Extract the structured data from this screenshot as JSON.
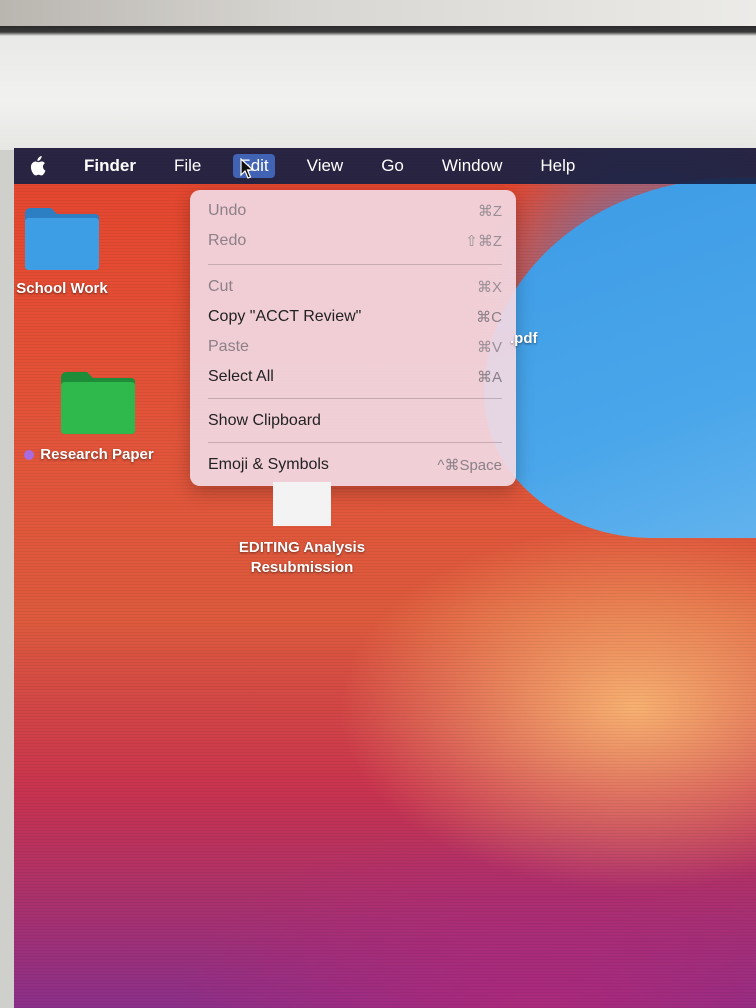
{
  "menubar": {
    "apple_icon": "apple-icon",
    "items": [
      "Finder",
      "File",
      "Edit",
      "View",
      "Go",
      "Window",
      "Help"
    ],
    "active": "Edit"
  },
  "edit_menu": {
    "items": [
      {
        "label": "Undo",
        "shortcut": "⌘Z",
        "enabled": false
      },
      {
        "label": "Redo",
        "shortcut": "⇧⌘Z",
        "enabled": false
      },
      {
        "label": "Cut",
        "shortcut": "⌘X",
        "enabled": false
      },
      {
        "label": "Copy \"ACCT Review\"",
        "shortcut": "⌘C",
        "enabled": true
      },
      {
        "label": "Paste",
        "shortcut": "⌘V",
        "enabled": false
      },
      {
        "label": "Select All",
        "shortcut": "⌘A",
        "enabled": true
      },
      {
        "label": "Show Clipboard",
        "shortcut": "",
        "enabled": true
      },
      {
        "label": "Emoji & Symbols",
        "shortcut": "^⌘Space",
        "enabled": true
      }
    ]
  },
  "desktop": {
    "icons": [
      {
        "label": "School Work",
        "kind": "folder",
        "color": "#3d9ee6"
      },
      {
        "label": "Research Paper",
        "kind": "folder",
        "color": "#2fb84c",
        "tag_color": "#a96be0"
      },
      {
        "label": ".pdf",
        "kind": "file"
      },
      {
        "label": "EDITING Analysis Resubmission",
        "kind": "file"
      }
    ]
  }
}
